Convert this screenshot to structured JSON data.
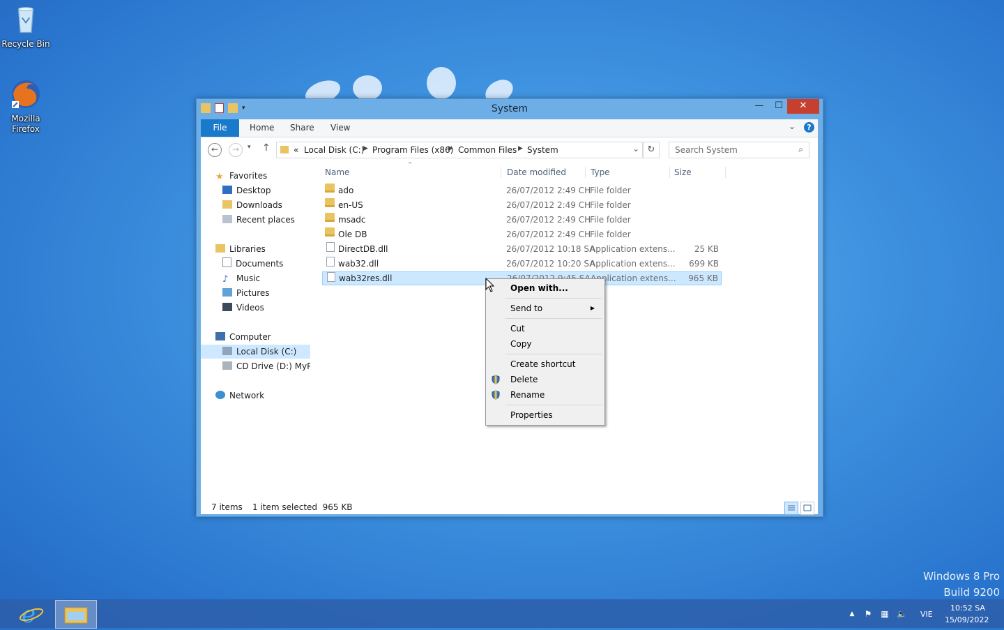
{
  "desktop": {
    "icons": [
      {
        "label": "Recycle Bin"
      },
      {
        "label": "Mozilla Firefox"
      }
    ],
    "watermark": {
      "line1": "Windows 8 Pro",
      "line2": "Build 9200"
    }
  },
  "window": {
    "title": "System",
    "ribbon_tabs": [
      "File",
      "Home",
      "Share",
      "View"
    ],
    "help_label": "?",
    "address": {
      "overflow": "«",
      "crumbs": [
        "Local Disk (C:)",
        "Program Files (x86)",
        "Common Files",
        "System"
      ]
    },
    "search": {
      "placeholder": "Search System"
    },
    "nav_pane": {
      "favorites": {
        "label": "Favorites",
        "items": [
          "Desktop",
          "Downloads",
          "Recent places"
        ]
      },
      "libraries": {
        "label": "Libraries",
        "items": [
          "Documents",
          "Music",
          "Pictures",
          "Videos"
        ]
      },
      "computer": {
        "label": "Computer",
        "items": [
          "Local Disk (C:)",
          "CD Drive (D:) MyPal"
        ]
      },
      "network": {
        "label": "Network"
      }
    },
    "columns": [
      "Name",
      "Date modified",
      "Type",
      "Size"
    ],
    "files": [
      {
        "name": "ado",
        "date": "26/07/2012 2:49 CH",
        "type": "File folder",
        "size": "",
        "kind": "folder"
      },
      {
        "name": "en-US",
        "date": "26/07/2012 2:49 CH",
        "type": "File folder",
        "size": "",
        "kind": "folder"
      },
      {
        "name": "msadc",
        "date": "26/07/2012 2:49 CH",
        "type": "File folder",
        "size": "",
        "kind": "folder"
      },
      {
        "name": "Ole DB",
        "date": "26/07/2012 2:49 CH",
        "type": "File folder",
        "size": "",
        "kind": "folder"
      },
      {
        "name": "DirectDB.dll",
        "date": "26/07/2012 10:18 SA",
        "type": "Application extens...",
        "size": "25 KB",
        "kind": "file"
      },
      {
        "name": "wab32.dll",
        "date": "26/07/2012 10:20 SA",
        "type": "Application extens...",
        "size": "699 KB",
        "kind": "file"
      },
      {
        "name": "wab32res.dll",
        "date": "26/07/2012 9:45 SA",
        "type": "Application extens...",
        "size": "965 KB",
        "kind": "file",
        "selected": true
      }
    ],
    "status": {
      "count": "7 items",
      "selection": "1 item selected  965 KB"
    }
  },
  "context_menu": {
    "items": [
      {
        "label": "Open with...",
        "bold": true
      },
      {
        "label": "Send to",
        "submenu": true
      },
      {
        "label": "Cut"
      },
      {
        "label": "Copy"
      },
      {
        "label": "Create shortcut"
      },
      {
        "label": "Delete",
        "shield": true
      },
      {
        "label": "Rename",
        "shield": true
      },
      {
        "label": "Properties"
      }
    ]
  },
  "taskbar": {
    "language": "VIE",
    "time": "10:52 SA",
    "date": "15/09/2022"
  },
  "colors": {
    "accent": "#1979ca",
    "selection": "#cce8ff",
    "close": "#c7402f"
  }
}
